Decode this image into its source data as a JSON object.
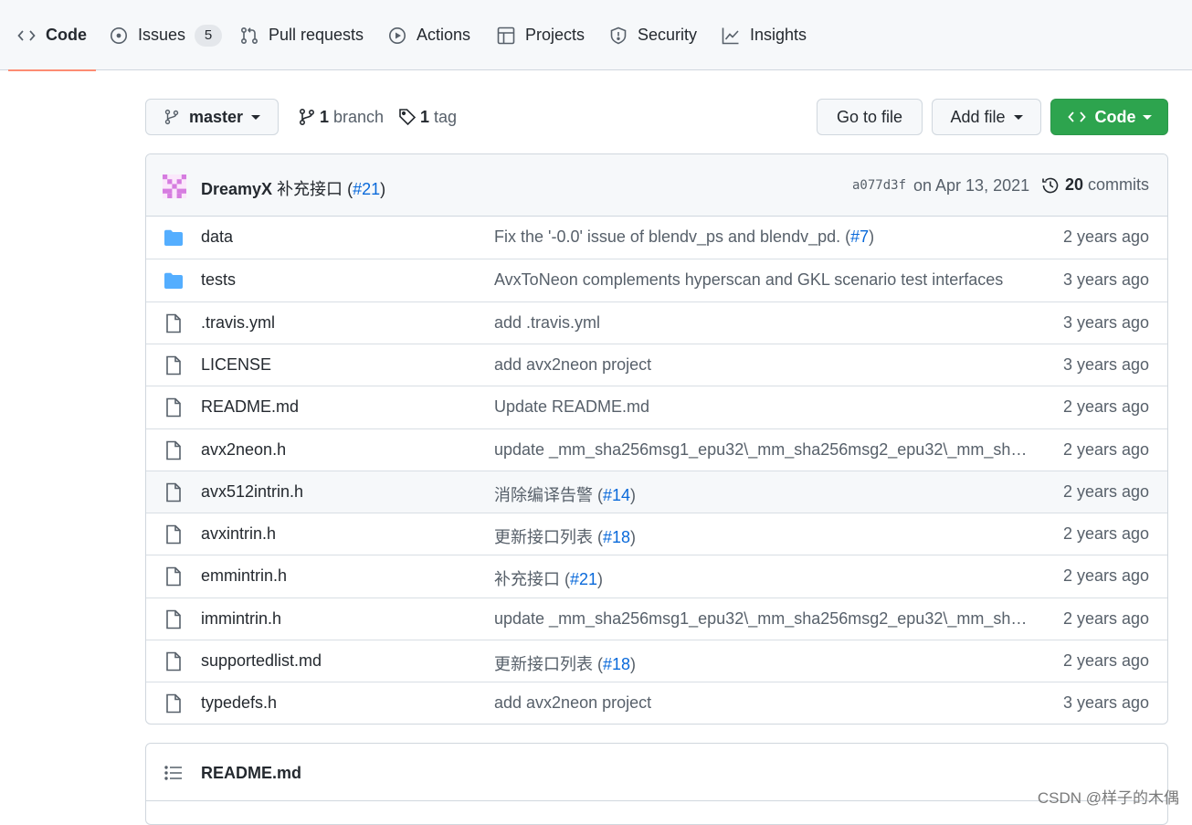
{
  "tabs": [
    {
      "label": "Code",
      "icon": "code-icon",
      "selected": true
    },
    {
      "label": "Issues",
      "icon": "issue-opened-icon",
      "count": "5"
    },
    {
      "label": "Pull requests",
      "icon": "git-pull-request-icon"
    },
    {
      "label": "Actions",
      "icon": "play-icon"
    },
    {
      "label": "Projects",
      "icon": "table-icon"
    },
    {
      "label": "Security",
      "icon": "shield-icon"
    },
    {
      "label": "Insights",
      "icon": "graph-icon"
    }
  ],
  "toolbar": {
    "branch_name": "master",
    "branch_count": "1",
    "branch_label": "branch",
    "tag_count": "1",
    "tag_label": "tag",
    "go_to_file": "Go to file",
    "add_file": "Add file",
    "code_button": "Code"
  },
  "latest_commit": {
    "author": "DreamyX",
    "message": "补充接口 (",
    "pr": "#21",
    "message_end": ")",
    "sha": "a077d3f",
    "date": "on Apr 13, 2021",
    "commit_count": "20",
    "commit_label": "commits"
  },
  "files": [
    {
      "type": "dir",
      "name": "data",
      "msg": "Fix the '-0.0' issue of blendv_ps and blendv_pd. (",
      "pr": "#7",
      "msg_end": ")",
      "age": "2 years ago"
    },
    {
      "type": "dir",
      "name": "tests",
      "msg": "AvxToNeon complements hyperscan and GKL scenario test interfaces",
      "pr": "",
      "msg_end": "",
      "age": "3 years ago"
    },
    {
      "type": "file",
      "name": ".travis.yml",
      "msg": "add .travis.yml",
      "pr": "",
      "msg_end": "",
      "age": "3 years ago"
    },
    {
      "type": "file",
      "name": "LICENSE",
      "msg": "add avx2neon project",
      "pr": "",
      "msg_end": "",
      "age": "3 years ago"
    },
    {
      "type": "file",
      "name": "README.md",
      "msg": "Update README.md",
      "pr": "",
      "msg_end": "",
      "age": "2 years ago"
    },
    {
      "type": "file",
      "name": "avx2neon.h",
      "msg": "update _mm_sha256msg1_epu32\\_mm_sha256msg2_epu32\\_mm_sha25...",
      "pr": "",
      "msg_end": "",
      "age": "2 years ago"
    },
    {
      "type": "file",
      "name": "avx512intrin.h",
      "msg": "消除编译告警 (",
      "pr": "#14",
      "msg_end": ")",
      "age": "2 years ago"
    },
    {
      "type": "file",
      "name": "avxintrin.h",
      "msg": "更新接口列表 (",
      "pr": "#18",
      "msg_end": ")",
      "age": "2 years ago"
    },
    {
      "type": "file",
      "name": "emmintrin.h",
      "msg": "补充接口 (",
      "pr": "#21",
      "msg_end": ")",
      "age": "2 years ago"
    },
    {
      "type": "file",
      "name": "immintrin.h",
      "msg": "update _mm_sha256msg1_epu32\\_mm_sha256msg2_epu32\\_mm_sha25...",
      "pr": "",
      "msg_end": "",
      "age": "2 years ago"
    },
    {
      "type": "file",
      "name": "supportedlist.md",
      "msg": "更新接口列表 (",
      "pr": "#18",
      "msg_end": ")",
      "age": "2 years ago"
    },
    {
      "type": "file",
      "name": "typedefs.h",
      "msg": "add avx2neon project",
      "pr": "",
      "msg_end": "",
      "age": "3 years ago"
    }
  ],
  "readme": {
    "title": "README.md"
  },
  "watermark": "CSDN @样子的木偶",
  "colors": {
    "accent_green": "#2da44e",
    "link_blue": "#0969da",
    "folder_blue": "#54aeff",
    "tab_underline": "#fd8c73"
  }
}
